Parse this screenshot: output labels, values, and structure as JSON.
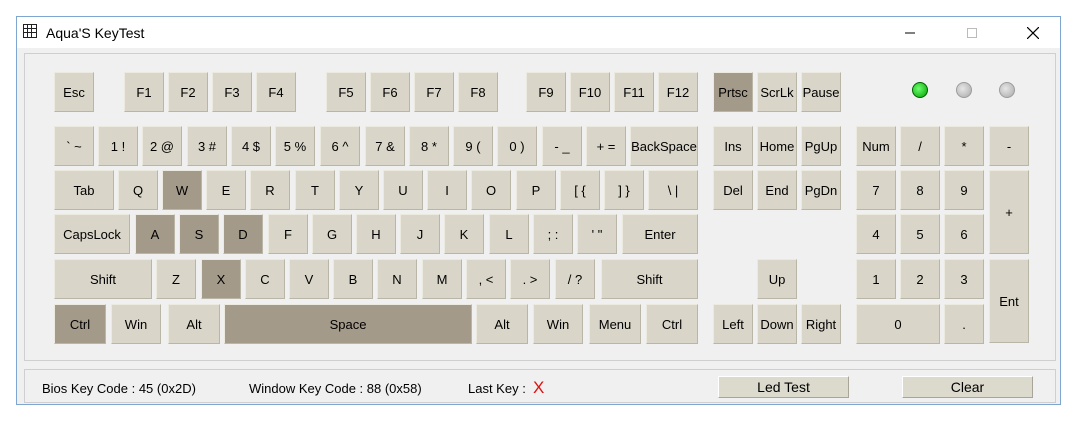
{
  "window": {
    "title": "Aqua'S KeyTest",
    "icon": "keyboard-grid-icon",
    "controls": [
      "minimize-icon",
      "maximize-icon",
      "close-icon"
    ]
  },
  "keys": {
    "esc": "Esc",
    "f1": "F1",
    "f2": "F2",
    "f3": "F3",
    "f4": "F4",
    "f5": "F5",
    "f6": "F6",
    "f7": "F7",
    "f8": "F8",
    "f9": "F9",
    "f10": "F10",
    "f11": "F11",
    "f12": "F12",
    "prtsc": "Prtsc",
    "scrlk": "ScrLk",
    "pause": "Pause",
    "backtick": "` ~",
    "n1": "1 !",
    "n2": "2 @",
    "n3": "3 #",
    "n4": "4 $",
    "n5": "5 %",
    "n6": "6 ^",
    "n7": "7 &",
    "n8": "8 *",
    "n9": "9 (",
    "n0": "0 )",
    "minus": "- _",
    "equals": "+ =",
    "backspace": "BackSpace",
    "tab": "Tab",
    "q": "Q",
    "w": "W",
    "e": "E",
    "r": "R",
    "t": "T",
    "y": "Y",
    "u": "U",
    "i": "I",
    "o": "O",
    "p": "P",
    "lbracket": "[ {",
    "rbracket": "] }",
    "backslash": "\\ |",
    "capslock": "CapsLock",
    "a": "A",
    "s": "S",
    "d": "D",
    "f": "F",
    "g": "G",
    "h": "H",
    "j": "J",
    "k": "K",
    "l": "L",
    "semicolon": "; :",
    "quote": "' \"",
    "enter": "Enter",
    "lshift": "Shift",
    "z": "Z",
    "x": "X",
    "c": "C",
    "v": "V",
    "b": "B",
    "n": "N",
    "m": "M",
    "comma": ", <",
    "period": ". >",
    "slash": "/ ?",
    "rshift": "Shift",
    "lctrl": "Ctrl",
    "lwin": "Win",
    "lalt": "Alt",
    "space": "Space",
    "ralt": "Alt",
    "rwin": "Win",
    "menu": "Menu",
    "rctrl": "Ctrl",
    "ins": "Ins",
    "home": "Home",
    "pgup": "PgUp",
    "del": "Del",
    "end": "End",
    "pgdn": "PgDn",
    "up": "Up",
    "left": "Left",
    "down": "Down",
    "right": "Right",
    "num": "Num",
    "kpslash": "/",
    "kpstar": "*",
    "kpminus": "-",
    "kp7": "7",
    "kp8": "8",
    "kp9": "9",
    "kpplus": "+",
    "kp4": "4",
    "kp5": "5",
    "kp6": "6",
    "kp1": "1",
    "kp2": "2",
    "kp3": "3",
    "kpenter": "Ent",
    "kp0": "0",
    "kpdot": "."
  },
  "pressed_keys": [
    "w",
    "a",
    "s",
    "d",
    "x",
    "lctrl",
    "space",
    "prtsc"
  ],
  "leds": [
    {
      "name": "numlock-led",
      "on": true
    },
    {
      "name": "capslock-led",
      "on": false
    },
    {
      "name": "scrolllock-led",
      "on": false
    }
  ],
  "colors": {
    "key": "#d9d6c9",
    "key_pressed": "#a49a8a",
    "led_on": "#00c000",
    "last_key": "#e01010"
  },
  "status": {
    "bios_code": "Bios Key Code : 45 (0x2D)",
    "window_code": "Window Key Code : 88 (0x58)",
    "last_key_label": "Last Key :",
    "last_key_value": "X",
    "led_test_label": "Led Test",
    "clear_label": "Clear"
  }
}
